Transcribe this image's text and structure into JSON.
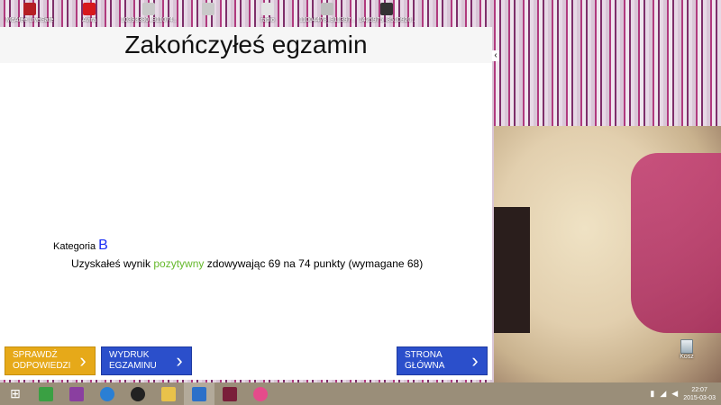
{
  "desktop": {
    "icons": [
      {
        "label": "McAfee LiveSafe",
        "icon": "mcafee-icon",
        "color": "#b51f24"
      },
      {
        "label": "Avira",
        "icon": "avira-icon",
        "color": "#d7191c"
      },
      {
        "label": "10393380_911074...",
        "icon": "file-icon",
        "color": "#c9c9c9"
      },
      {
        "label": "",
        "icon": "file-icon",
        "color": "#c9c9c9"
      },
      {
        "label": "radio",
        "icon": "file-icon",
        "color": "#e3e3e3"
      },
      {
        "label": "11004478_911397...",
        "icon": "file-icon",
        "color": "#bdbdbd"
      },
      {
        "label": "1425975_8510920...",
        "icon": "file-icon",
        "color": "#333333"
      }
    ],
    "recycle_bin_label": "Kosz"
  },
  "app": {
    "title": "Zakończyłeś egzamin",
    "category_label": "Kategoria",
    "category_value": "B",
    "result": {
      "prefix": "Uzyskałeś wynik",
      "status": "pozytywny",
      "suffix": "zdowywając 69 na 74 punkty (wymagane 68)"
    },
    "buttons": {
      "check_answers": "SPRAWDŹ ODPOWIEDZI",
      "print_exam": "WYDRUK EGZAMINU",
      "home": "STRONA GŁÓWNA"
    },
    "chevron": "‹"
  },
  "taskbar": {
    "start_glyph": "⊞",
    "apps": [
      {
        "icon": "store-icon",
        "color": "#3aa043"
      },
      {
        "icon": "pictures-icon",
        "color": "#8a3fa0"
      },
      {
        "icon": "hp-icon",
        "color": "#2a7fd4"
      },
      {
        "icon": "camera-icon",
        "color": "#222222"
      },
      {
        "icon": "file-explorer-icon",
        "color": "#e8c24a"
      },
      {
        "icon": "maxthon-icon",
        "color": "#2b70c9"
      },
      {
        "icon": "game-icon",
        "color": "#7a1f3a"
      },
      {
        "icon": "picasa-icon",
        "color": "#e54b8b"
      }
    ],
    "time": "22:07",
    "date": "2015-03-03"
  }
}
